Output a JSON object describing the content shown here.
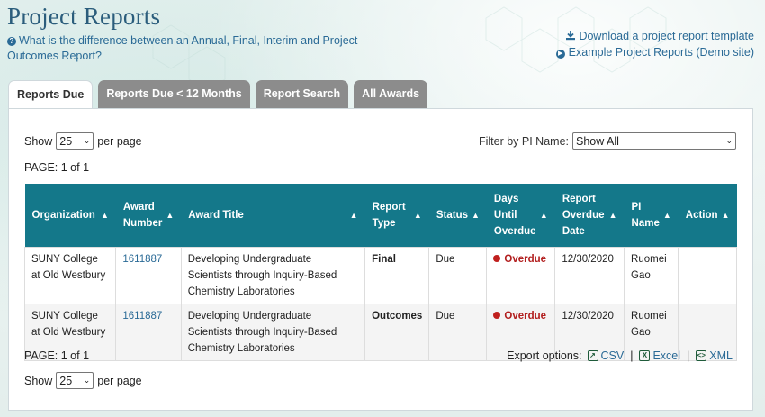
{
  "header": {
    "title": "Project Reports",
    "faq_link": "What is the difference between an Annual, Final, Interim and Project Outcomes Report?",
    "download_link": "Download a project report template",
    "example_link": "Example Project Reports (Demo site)"
  },
  "tabs": [
    {
      "label": "Reports Due",
      "active": true
    },
    {
      "label": "Reports Due < 12 Months",
      "active": false
    },
    {
      "label": "Report Search",
      "active": false
    },
    {
      "label": "All Awards",
      "active": false
    }
  ],
  "controls": {
    "show_label": "Show",
    "per_page_label": "per page",
    "per_page_value": "25",
    "filter_label": "Filter by PI Name:",
    "filter_value": "Show All",
    "page_info_top": "PAGE: 1 of 1",
    "page_info_bottom": "PAGE: 1 of 1"
  },
  "table": {
    "headers": [
      {
        "label": "Organization"
      },
      {
        "label": "Award Number"
      },
      {
        "label": "Award Title"
      },
      {
        "label": "Report Type"
      },
      {
        "label": "Status"
      },
      {
        "label": "Days Until Overdue"
      },
      {
        "label": "Report Overdue Date"
      },
      {
        "label": "PI Name"
      },
      {
        "label": "Action"
      }
    ],
    "rows": [
      {
        "organization": "SUNY College at Old Westbury",
        "award_number": "1611887",
        "award_title": "Developing Undergraduate Scientists through Inquiry-Based Chemistry Laboratories",
        "report_type": "Final",
        "status": "Due",
        "days_until_overdue": "Overdue",
        "report_overdue_date": "12/30/2020",
        "pi_name": "Ruomei Gao",
        "action": ""
      },
      {
        "organization": "SUNY College at Old Westbury",
        "award_number": "1611887",
        "award_title": "Developing Undergraduate Scientists through Inquiry-Based Chemistry Laboratories",
        "report_type": "Outcomes",
        "status": "Due",
        "days_until_overdue": "Overdue",
        "report_overdue_date": "12/30/2020",
        "pi_name": "Ruomei Gao",
        "action": ""
      }
    ]
  },
  "export": {
    "label": "Export options:",
    "csv": "CSV",
    "excel": "Excel",
    "xml": "XML",
    "separator": "|"
  },
  "colors": {
    "title": "#2b5d7c",
    "link": "#2a6a96",
    "table_header": "#14788a",
    "tab_inactive": "#8c8c8c",
    "overdue": "#c0201e"
  }
}
